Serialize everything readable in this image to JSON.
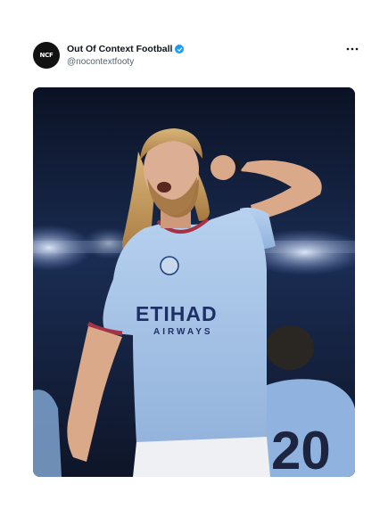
{
  "tweet": {
    "account": {
      "display_name": "Out Of Context Football",
      "handle": "@nocontextfooty",
      "avatar_text": "NCF",
      "verified": true
    },
    "more_icon": "ellipsis-icon",
    "media": {
      "jersey_sponsor_line1": "ETIHAD",
      "jersey_sponsor_line2": "AIRWAYS",
      "background_jersey_number": "20"
    }
  },
  "colors": {
    "verified_badge": "#1d9bf0",
    "name_text": "#0f1419",
    "handle_text": "#536471",
    "jersey_sky_blue": "#a9c6e8",
    "stadium_dark": "#101a33"
  }
}
